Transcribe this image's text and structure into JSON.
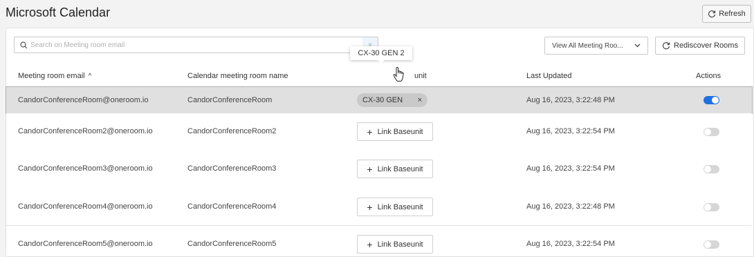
{
  "header": {
    "title": "Microsoft Calendar",
    "refresh_label": "Refresh"
  },
  "toolbar": {
    "search_placeholder": "Search on Meeting room email",
    "search_clear": "×",
    "view_select_value": "View All Meeting Roo...",
    "rediscover_label": "Rediscover Rooms"
  },
  "table": {
    "columns": {
      "email": "Meeting room email",
      "name": "Calendar meeting room name",
      "baseunit": "unit",
      "updated": "Last Updated",
      "actions": "Actions"
    },
    "sort_indicator": "^",
    "link_label": "Link Baseunit",
    "rows": [
      {
        "email": "CandorConferenceRoom@oneroom.io",
        "name": "CandorConferenceRoom",
        "baseunit": "CX-30 GEN",
        "updated": "Aug 16, 2023, 3:22:48 PM",
        "enabled": true
      },
      {
        "email": "CandorConferenceRoom2@oneroom.io",
        "name": "CandorConferenceRoom2",
        "baseunit": "",
        "updated": "Aug 16, 2023, 3:22:54 PM",
        "enabled": false
      },
      {
        "email": "CandorConferenceRoom3@oneroom.io",
        "name": "CandorConferenceRoom3",
        "baseunit": "",
        "updated": "Aug 16, 2023, 3:22:54 PM",
        "enabled": false
      },
      {
        "email": "CandorConferenceRoom4@oneroom.io",
        "name": "CandorConferenceRoom4",
        "baseunit": "",
        "updated": "Aug 16, 2023, 3:22:48 PM",
        "enabled": false
      },
      {
        "email": "CandorConferenceRoom5@oneroom.io",
        "name": "CandorConferenceRoom5",
        "baseunit": "",
        "updated": "Aug 16, 2023, 3:22:54 PM",
        "enabled": false
      }
    ],
    "chip_remove": "×"
  },
  "tooltip": {
    "text": "CX-30 GEN 2"
  },
  "colors": {
    "accent": "#1f6fe0",
    "selected_row": "#e0e0e0"
  }
}
